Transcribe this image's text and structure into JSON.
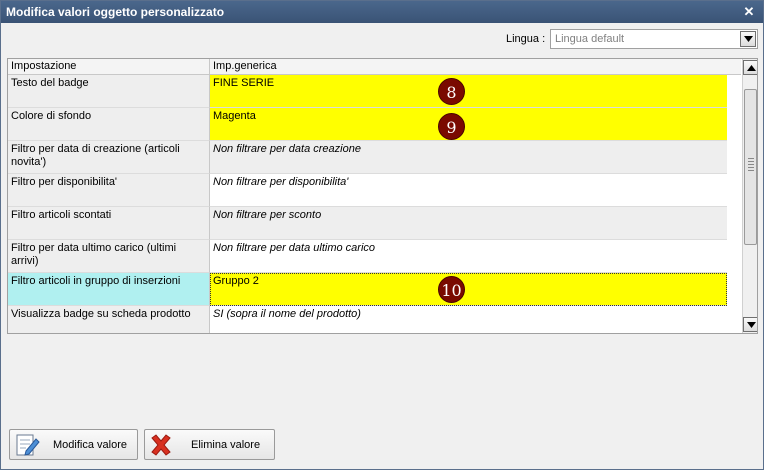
{
  "window": {
    "title": "Modifica valori oggetto personalizzato",
    "close_icon": "close-icon"
  },
  "language": {
    "label": "Lingua :",
    "value": "Lingua default"
  },
  "grid": {
    "headers": [
      "Impostazione",
      "Imp.generica"
    ],
    "rows": [
      {
        "setting": "Testo del badge",
        "value": "FINE SERIE",
        "italic": false,
        "color": "#ffff00",
        "badge": "8"
      },
      {
        "setting": "Colore di sfondo",
        "value": "Magenta",
        "italic": false,
        "color": "#ffff00",
        "badge": "9"
      },
      {
        "setting": "Filtro per data di creazione (articoli novita')",
        "value": "Non filtrare per data creazione",
        "italic": true,
        "color": "#eeeeee"
      },
      {
        "setting": "Filtro per disponibilita'",
        "value": "Non filtrare per disponibilita'",
        "italic": true,
        "color": "#ffffff"
      },
      {
        "setting": "Filtro articoli scontati",
        "value": "Non filtrare per sconto",
        "italic": true,
        "color": "#eeeeee"
      },
      {
        "setting": "Filtro per data ultimo carico (ultimi arrivi)",
        "value": "Non filtrare per data ultimo carico",
        "italic": true,
        "color": "#ffffff"
      },
      {
        "setting": "Filtro articoli in gruppo di inserzioni",
        "value": "Gruppo 2",
        "italic": false,
        "color": "#ffff00",
        "badge": "10",
        "selected": true
      },
      {
        "setting": "Visualizza badge su scheda prodotto",
        "value": "SI (sopra il nome del prodotto)",
        "italic": true,
        "color": "#ffffff"
      }
    ]
  },
  "buttons": {
    "edit": {
      "label": "Modifica valore",
      "icon": "edit-document-icon"
    },
    "delete": {
      "label": "Elimina valore",
      "icon": "red-x-icon"
    }
  }
}
